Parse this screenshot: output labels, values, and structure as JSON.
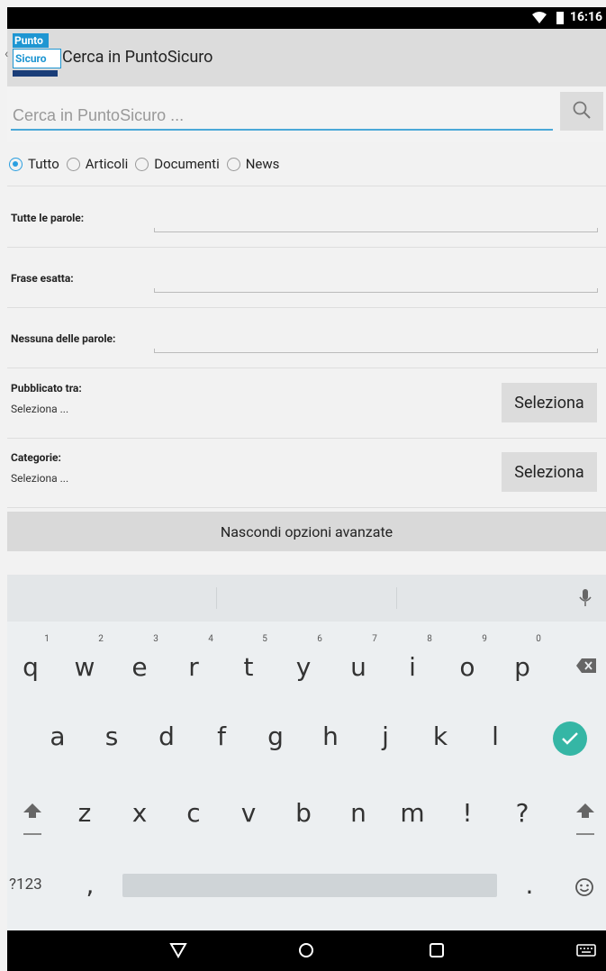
{
  "status_bar": {
    "time": "16:16"
  },
  "app_bar": {
    "logo_line1": "Punto",
    "logo_line2": "Sicuro",
    "title": "Cerca in PuntoSicuro"
  },
  "search": {
    "placeholder": "Cerca in PuntoSicuro ..."
  },
  "filter_options": [
    {
      "label": "Tutto",
      "selected": true
    },
    {
      "label": "Articoli",
      "selected": false
    },
    {
      "label": "Documenti",
      "selected": false
    },
    {
      "label": "News",
      "selected": false
    }
  ],
  "fields": {
    "all_words": "Tutte le parole:",
    "exact_phrase": "Frase esatta:",
    "none_words": "Nessuna delle parole:"
  },
  "published": {
    "label": "Pubblicato tra:",
    "value": "Seleziona ...",
    "button": "Seleziona"
  },
  "categories": {
    "label": "Categorie:",
    "value": "Seleziona ...",
    "button": "Seleziona"
  },
  "toggle_advanced": "Nascondi opzioni avanzate",
  "keyboard": {
    "row1": [
      "q",
      "w",
      "e",
      "r",
      "t",
      "y",
      "u",
      "i",
      "o",
      "p"
    ],
    "hints": [
      "1",
      "2",
      "3",
      "4",
      "5",
      "6",
      "7",
      "8",
      "9",
      "0"
    ],
    "row2": [
      "a",
      "s",
      "d",
      "f",
      "g",
      "h",
      "j",
      "k",
      "l"
    ],
    "row3": [
      "z",
      "x",
      "c",
      "v",
      "b",
      "n",
      "m",
      "!",
      "?"
    ],
    "symbols_key": "?123",
    "comma": ",",
    "period": "."
  },
  "colors": {
    "accent": "#2b9fe0",
    "enter": "#35b6a5"
  }
}
